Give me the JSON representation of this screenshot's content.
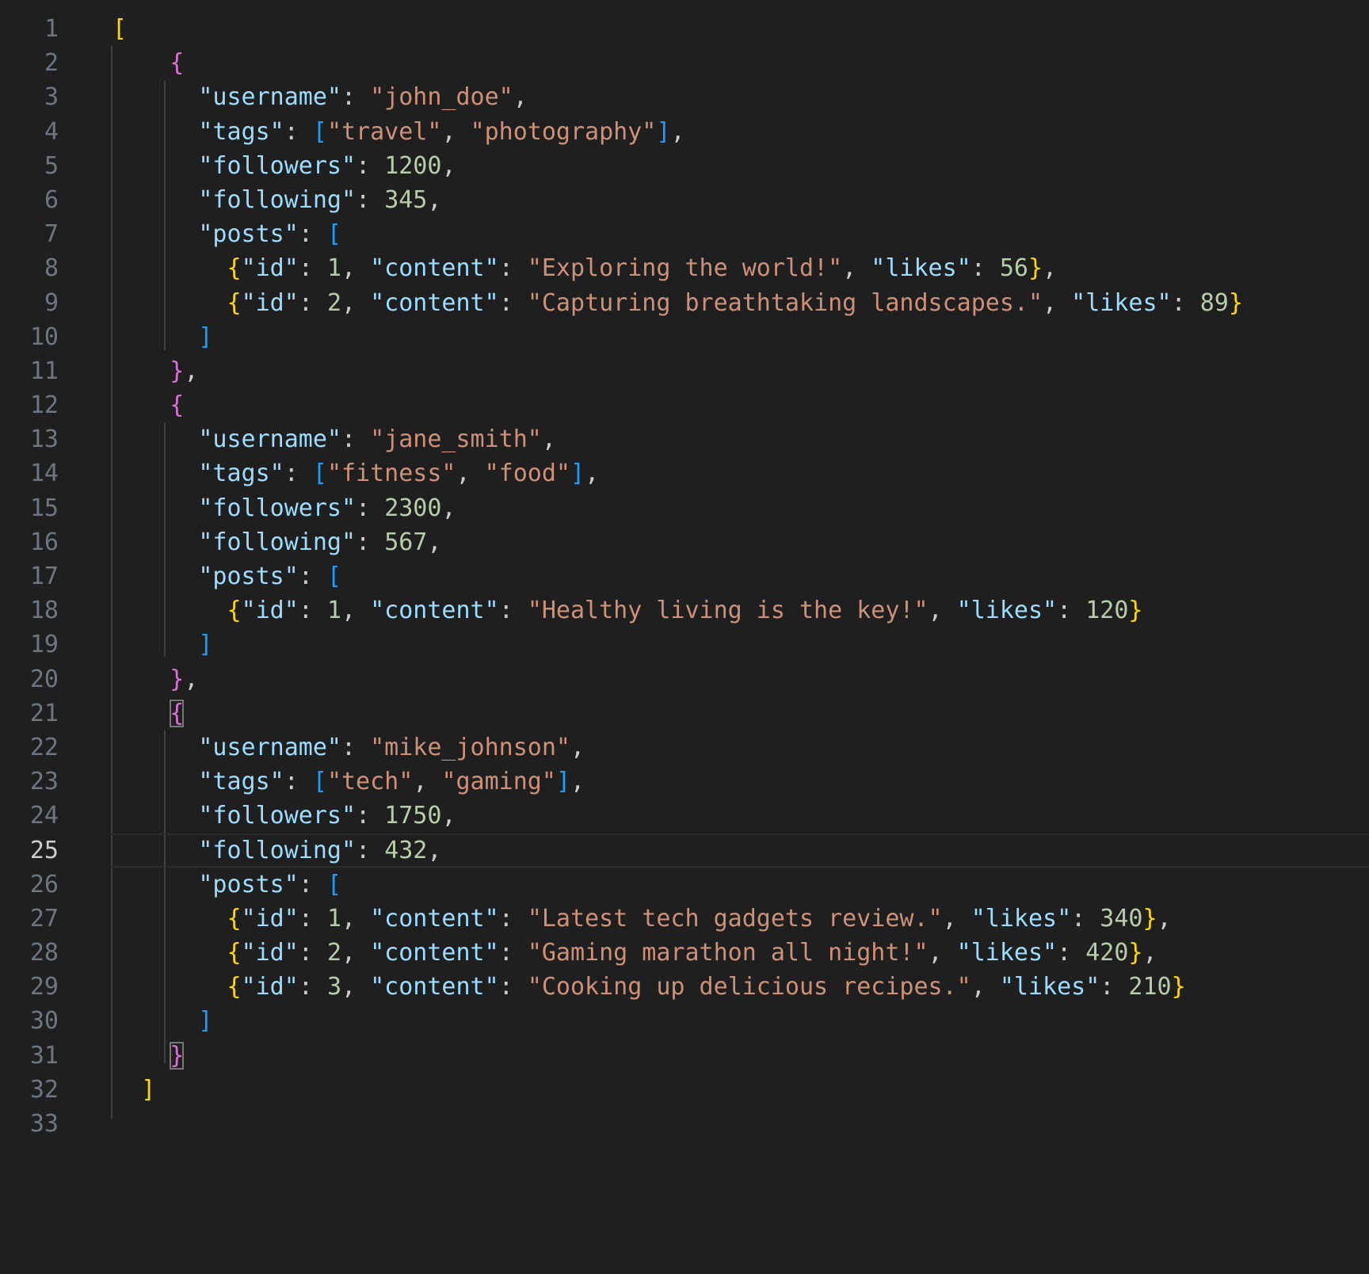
{
  "editor": {
    "language": "json",
    "current_line": 25,
    "colors": {
      "background": "#1f1f1f",
      "line_number": "#6e7681",
      "key": "#9cdcfe",
      "string": "#ce9178",
      "number": "#b5cea8",
      "bracket_level_1": "#ffd700",
      "bracket_level_2": "#da70d6",
      "bracket_level_3": "#179fff"
    },
    "lines": [
      {
        "n": 1,
        "tokens": [
          [
            "b1",
            "["
          ]
        ]
      },
      {
        "n": 2,
        "tokens": [
          [
            "ind",
            "    "
          ],
          [
            "b2",
            "{"
          ]
        ]
      },
      {
        "n": 3,
        "tokens": [
          [
            "ind",
            "      "
          ],
          [
            "key",
            "\"username\""
          ],
          [
            "punct",
            ": "
          ],
          [
            "str",
            "\"john_doe\""
          ],
          [
            "punct",
            ","
          ]
        ]
      },
      {
        "n": 4,
        "tokens": [
          [
            "ind",
            "      "
          ],
          [
            "key",
            "\"tags\""
          ],
          [
            "punct",
            ": "
          ],
          [
            "b3",
            "["
          ],
          [
            "str",
            "\"travel\""
          ],
          [
            "punct",
            ", "
          ],
          [
            "str",
            "\"photography\""
          ],
          [
            "b3",
            "]"
          ],
          [
            "punct",
            ","
          ]
        ]
      },
      {
        "n": 5,
        "tokens": [
          [
            "ind",
            "      "
          ],
          [
            "key",
            "\"followers\""
          ],
          [
            "punct",
            ": "
          ],
          [
            "num",
            "1200"
          ],
          [
            "punct",
            ","
          ]
        ]
      },
      {
        "n": 6,
        "tokens": [
          [
            "ind",
            "      "
          ],
          [
            "key",
            "\"following\""
          ],
          [
            "punct",
            ": "
          ],
          [
            "num",
            "345"
          ],
          [
            "punct",
            ","
          ]
        ]
      },
      {
        "n": 7,
        "tokens": [
          [
            "ind",
            "      "
          ],
          [
            "key",
            "\"posts\""
          ],
          [
            "punct",
            ": "
          ],
          [
            "b3",
            "["
          ]
        ]
      },
      {
        "n": 8,
        "tokens": [
          [
            "ind",
            "        "
          ],
          [
            "b1",
            "{"
          ],
          [
            "key",
            "\"id\""
          ],
          [
            "punct",
            ": "
          ],
          [
            "num",
            "1"
          ],
          [
            "punct",
            ", "
          ],
          [
            "key",
            "\"content\""
          ],
          [
            "punct",
            ": "
          ],
          [
            "str",
            "\"Exploring the world!\""
          ],
          [
            "punct",
            ", "
          ],
          [
            "key",
            "\"likes\""
          ],
          [
            "punct",
            ": "
          ],
          [
            "num",
            "56"
          ],
          [
            "b1",
            "}"
          ],
          [
            "punct",
            ","
          ]
        ]
      },
      {
        "n": 9,
        "tokens": [
          [
            "ind",
            "        "
          ],
          [
            "b1",
            "{"
          ],
          [
            "key",
            "\"id\""
          ],
          [
            "punct",
            ": "
          ],
          [
            "num",
            "2"
          ],
          [
            "punct",
            ", "
          ],
          [
            "key",
            "\"content\""
          ],
          [
            "punct",
            ": "
          ],
          [
            "str",
            "\"Capturing breathtaking landscapes.\""
          ],
          [
            "punct",
            ", "
          ],
          [
            "key",
            "\"likes\""
          ],
          [
            "punct",
            ": "
          ],
          [
            "num",
            "89"
          ],
          [
            "b1",
            "}"
          ]
        ]
      },
      {
        "n": 10,
        "tokens": [
          [
            "ind",
            "      "
          ],
          [
            "b3",
            "]"
          ]
        ]
      },
      {
        "n": 11,
        "tokens": [
          [
            "ind",
            "    "
          ],
          [
            "b2",
            "}"
          ],
          [
            "punct",
            ","
          ]
        ]
      },
      {
        "n": 12,
        "tokens": [
          [
            "ind",
            "    "
          ],
          [
            "b2",
            "{"
          ]
        ]
      },
      {
        "n": 13,
        "tokens": [
          [
            "ind",
            "      "
          ],
          [
            "key",
            "\"username\""
          ],
          [
            "punct",
            ": "
          ],
          [
            "str",
            "\"jane_smith\""
          ],
          [
            "punct",
            ","
          ]
        ]
      },
      {
        "n": 14,
        "tokens": [
          [
            "ind",
            "      "
          ],
          [
            "key",
            "\"tags\""
          ],
          [
            "punct",
            ": "
          ],
          [
            "b3",
            "["
          ],
          [
            "str",
            "\"fitness\""
          ],
          [
            "punct",
            ", "
          ],
          [
            "str",
            "\"food\""
          ],
          [
            "b3",
            "]"
          ],
          [
            "punct",
            ","
          ]
        ]
      },
      {
        "n": 15,
        "tokens": [
          [
            "ind",
            "      "
          ],
          [
            "key",
            "\"followers\""
          ],
          [
            "punct",
            ": "
          ],
          [
            "num",
            "2300"
          ],
          [
            "punct",
            ","
          ]
        ]
      },
      {
        "n": 16,
        "tokens": [
          [
            "ind",
            "      "
          ],
          [
            "key",
            "\"following\""
          ],
          [
            "punct",
            ": "
          ],
          [
            "num",
            "567"
          ],
          [
            "punct",
            ","
          ]
        ]
      },
      {
        "n": 17,
        "tokens": [
          [
            "ind",
            "      "
          ],
          [
            "key",
            "\"posts\""
          ],
          [
            "punct",
            ": "
          ],
          [
            "b3",
            "["
          ]
        ]
      },
      {
        "n": 18,
        "tokens": [
          [
            "ind",
            "        "
          ],
          [
            "b1",
            "{"
          ],
          [
            "key",
            "\"id\""
          ],
          [
            "punct",
            ": "
          ],
          [
            "num",
            "1"
          ],
          [
            "punct",
            ", "
          ],
          [
            "key",
            "\"content\""
          ],
          [
            "punct",
            ": "
          ],
          [
            "str",
            "\"Healthy living is the key!\""
          ],
          [
            "punct",
            ", "
          ],
          [
            "key",
            "\"likes\""
          ],
          [
            "punct",
            ": "
          ],
          [
            "num",
            "120"
          ],
          [
            "b1",
            "}"
          ]
        ]
      },
      {
        "n": 19,
        "tokens": [
          [
            "ind",
            "      "
          ],
          [
            "b3",
            "]"
          ]
        ]
      },
      {
        "n": 20,
        "tokens": [
          [
            "ind",
            "    "
          ],
          [
            "b2",
            "}"
          ],
          [
            "punct",
            ","
          ]
        ]
      },
      {
        "n": 21,
        "tokens": [
          [
            "ind",
            "    "
          ],
          [
            "b2 match",
            "{"
          ]
        ]
      },
      {
        "n": 22,
        "tokens": [
          [
            "ind",
            "      "
          ],
          [
            "key",
            "\"username\""
          ],
          [
            "punct",
            ": "
          ],
          [
            "str",
            "\"mike_johnson\""
          ],
          [
            "punct",
            ","
          ]
        ]
      },
      {
        "n": 23,
        "tokens": [
          [
            "ind",
            "      "
          ],
          [
            "key",
            "\"tags\""
          ],
          [
            "punct",
            ": "
          ],
          [
            "b3",
            "["
          ],
          [
            "str",
            "\"tech\""
          ],
          [
            "punct",
            ", "
          ],
          [
            "str",
            "\"gaming\""
          ],
          [
            "b3",
            "]"
          ],
          [
            "punct",
            ","
          ]
        ]
      },
      {
        "n": 24,
        "tokens": [
          [
            "ind",
            "      "
          ],
          [
            "key",
            "\"followers\""
          ],
          [
            "punct",
            ": "
          ],
          [
            "num",
            "1750"
          ],
          [
            "punct",
            ","
          ]
        ]
      },
      {
        "n": 25,
        "tokens": [
          [
            "ind",
            "      "
          ],
          [
            "key",
            "\"following\""
          ],
          [
            "punct",
            ": "
          ],
          [
            "num",
            "432"
          ],
          [
            "punct",
            ","
          ]
        ]
      },
      {
        "n": 26,
        "tokens": [
          [
            "ind",
            "      "
          ],
          [
            "key",
            "\"posts\""
          ],
          [
            "punct",
            ": "
          ],
          [
            "b3",
            "["
          ]
        ]
      },
      {
        "n": 27,
        "tokens": [
          [
            "ind",
            "        "
          ],
          [
            "b1",
            "{"
          ],
          [
            "key",
            "\"id\""
          ],
          [
            "punct",
            ": "
          ],
          [
            "num",
            "1"
          ],
          [
            "punct",
            ", "
          ],
          [
            "key",
            "\"content\""
          ],
          [
            "punct",
            ": "
          ],
          [
            "str",
            "\"Latest tech gadgets review.\""
          ],
          [
            "punct",
            ", "
          ],
          [
            "key",
            "\"likes\""
          ],
          [
            "punct",
            ": "
          ],
          [
            "num",
            "340"
          ],
          [
            "b1",
            "}"
          ],
          [
            "punct",
            ","
          ]
        ]
      },
      {
        "n": 28,
        "tokens": [
          [
            "ind",
            "        "
          ],
          [
            "b1",
            "{"
          ],
          [
            "key",
            "\"id\""
          ],
          [
            "punct",
            ": "
          ],
          [
            "num",
            "2"
          ],
          [
            "punct",
            ", "
          ],
          [
            "key",
            "\"content\""
          ],
          [
            "punct",
            ": "
          ],
          [
            "str",
            "\"Gaming marathon all night!\""
          ],
          [
            "punct",
            ", "
          ],
          [
            "key",
            "\"likes\""
          ],
          [
            "punct",
            ": "
          ],
          [
            "num",
            "420"
          ],
          [
            "b1",
            "}"
          ],
          [
            "punct",
            ","
          ]
        ]
      },
      {
        "n": 29,
        "tokens": [
          [
            "ind",
            "        "
          ],
          [
            "b1",
            "{"
          ],
          [
            "key",
            "\"id\""
          ],
          [
            "punct",
            ": "
          ],
          [
            "num",
            "3"
          ],
          [
            "punct",
            ", "
          ],
          [
            "key",
            "\"content\""
          ],
          [
            "punct",
            ": "
          ],
          [
            "str",
            "\"Cooking up delicious recipes.\""
          ],
          [
            "punct",
            ", "
          ],
          [
            "key",
            "\"likes\""
          ],
          [
            "punct",
            ": "
          ],
          [
            "num",
            "210"
          ],
          [
            "b1",
            "}"
          ]
        ]
      },
      {
        "n": 30,
        "tokens": [
          [
            "ind",
            "      "
          ],
          [
            "b3",
            "]"
          ]
        ]
      },
      {
        "n": 31,
        "tokens": [
          [
            "ind",
            "    "
          ],
          [
            "b2 match",
            "}"
          ]
        ]
      },
      {
        "n": 32,
        "tokens": [
          [
            "ind",
            "  "
          ],
          [
            "b1",
            "]"
          ]
        ]
      },
      {
        "n": 33,
        "tokens": []
      }
    ]
  }
}
